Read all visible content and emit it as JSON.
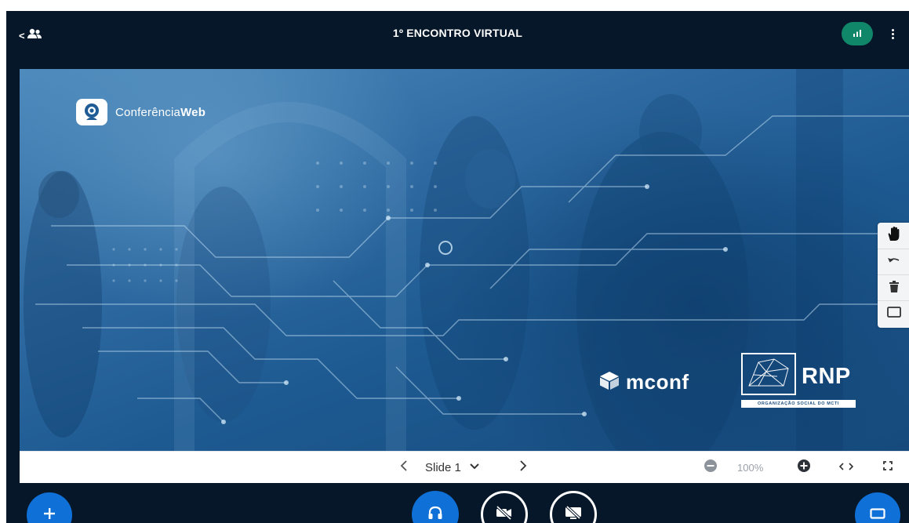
{
  "header": {
    "title": "1º ENCONTRO VIRTUAL",
    "users_toggle_icon": "users-icon",
    "connection_icon": "signal-bars-icon",
    "options_icon": "vertical-dots-icon"
  },
  "slide": {
    "brand_prefix": "Conferência",
    "brand_bold": "Web",
    "mconf_label": "mconf",
    "rnp_label": "RNP",
    "rnp_subtitle": "ORGANIZAÇÃO SOCIAL DO MCTI"
  },
  "annotation_tools": [
    "hand-icon",
    "undo-icon",
    "trash-icon",
    "whiteboard-icon"
  ],
  "controls": {
    "slide_label": "Slide 1",
    "zoom_value": "100%"
  },
  "bottom_bar": {
    "actions_icon": "plus-icon",
    "audio_icon": "headphones-icon",
    "video_icon": "video-off-icon",
    "screenshare_icon": "screenshare-off-icon",
    "layout_icon": "presentation-icon"
  },
  "colors": {
    "app_background": "#06172a",
    "accent_blue": "#0f70d7",
    "connection_green": "#11876a"
  }
}
